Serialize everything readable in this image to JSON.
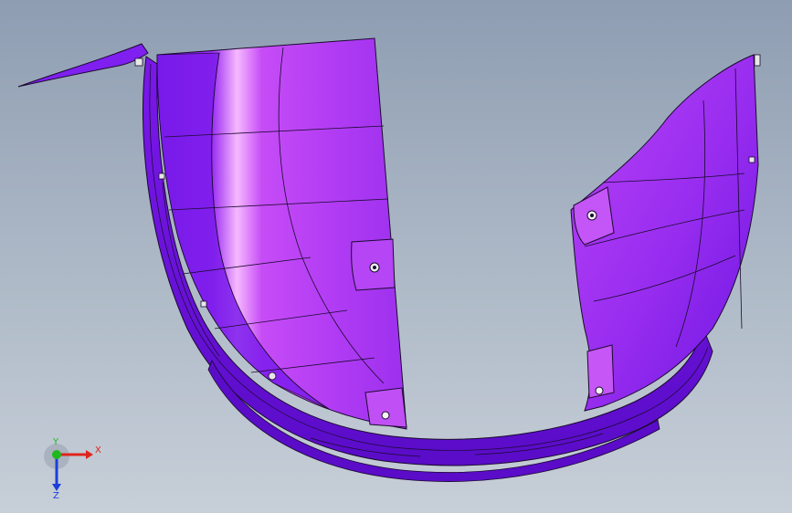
{
  "viewport": {
    "background_top": "#8e9db2",
    "background_bottom": "#c7cfd8"
  },
  "model": {
    "part_color": "#8a1cf0",
    "highlight_color": "#f2a6ff",
    "dark_color": "#5a0fc4",
    "edge_color": "#1a0b2e"
  },
  "triad": {
    "x_label": "X",
    "y_label": "Y",
    "z_label": "Z",
    "x_color": "#e0241c",
    "y_color": "#1fb81f",
    "z_color": "#1e3fd8"
  }
}
